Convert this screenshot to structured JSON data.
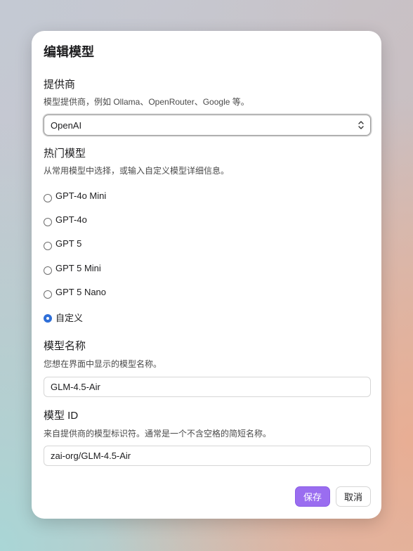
{
  "dialog": {
    "title": "编辑模型",
    "provider": {
      "label": "提供商",
      "description": "模型提供商，例如 Ollama、OpenRouter、Google 等。",
      "selected": "OpenAI"
    },
    "popular_models": {
      "label": "热门模型",
      "description": "从常用模型中选择，或输入自定义模型详细信息。",
      "options": [
        "GPT-4o Mini",
        "GPT-4o",
        "GPT 5",
        "GPT 5 Mini",
        "GPT 5 Nano",
        "自定义"
      ],
      "selected_index": 5
    },
    "model_name": {
      "label": "模型名称",
      "description": "您想在界面中显示的模型名称。",
      "value": "GLM-4.5-Air"
    },
    "model_id": {
      "label": "模型 ID",
      "description": "来自提供商的模型标识符。通常是一个不含空格的简短名称。",
      "value": "zai-org/GLM-4.5-Air"
    },
    "buttons": {
      "save": "保存",
      "cancel": "取消"
    }
  },
  "colors": {
    "accent": "#9a6df0",
    "radio_checked": "#2f6fd8"
  },
  "icons": {
    "select_chevron": "chevron-up-down-icon"
  }
}
